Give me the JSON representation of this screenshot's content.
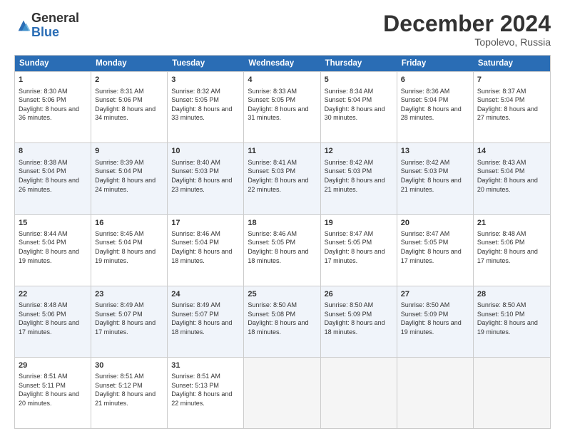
{
  "logo": {
    "general": "General",
    "blue": "Blue"
  },
  "title": "December 2024",
  "location": "Topolevo, Russia",
  "days": [
    "Sunday",
    "Monday",
    "Tuesday",
    "Wednesday",
    "Thursday",
    "Friday",
    "Saturday"
  ],
  "weeks": [
    [
      {
        "day": "1",
        "sunrise": "8:30 AM",
        "sunset": "5:06 PM",
        "daylight": "8 hours and 36 minutes."
      },
      {
        "day": "2",
        "sunrise": "8:31 AM",
        "sunset": "5:06 PM",
        "daylight": "8 hours and 34 minutes."
      },
      {
        "day": "3",
        "sunrise": "8:32 AM",
        "sunset": "5:05 PM",
        "daylight": "8 hours and 33 minutes."
      },
      {
        "day": "4",
        "sunrise": "8:33 AM",
        "sunset": "5:05 PM",
        "daylight": "8 hours and 31 minutes."
      },
      {
        "day": "5",
        "sunrise": "8:34 AM",
        "sunset": "5:04 PM",
        "daylight": "8 hours and 30 minutes."
      },
      {
        "day": "6",
        "sunrise": "8:36 AM",
        "sunset": "5:04 PM",
        "daylight": "8 hours and 28 minutes."
      },
      {
        "day": "7",
        "sunrise": "8:37 AM",
        "sunset": "5:04 PM",
        "daylight": "8 hours and 27 minutes."
      }
    ],
    [
      {
        "day": "8",
        "sunrise": "8:38 AM",
        "sunset": "5:04 PM",
        "daylight": "8 hours and 26 minutes."
      },
      {
        "day": "9",
        "sunrise": "8:39 AM",
        "sunset": "5:04 PM",
        "daylight": "8 hours and 24 minutes."
      },
      {
        "day": "10",
        "sunrise": "8:40 AM",
        "sunset": "5:03 PM",
        "daylight": "8 hours and 23 minutes."
      },
      {
        "day": "11",
        "sunrise": "8:41 AM",
        "sunset": "5:03 PM",
        "daylight": "8 hours and 22 minutes."
      },
      {
        "day": "12",
        "sunrise": "8:42 AM",
        "sunset": "5:03 PM",
        "daylight": "8 hours and 21 minutes."
      },
      {
        "day": "13",
        "sunrise": "8:42 AM",
        "sunset": "5:03 PM",
        "daylight": "8 hours and 21 minutes."
      },
      {
        "day": "14",
        "sunrise": "8:43 AM",
        "sunset": "5:04 PM",
        "daylight": "8 hours and 20 minutes."
      }
    ],
    [
      {
        "day": "15",
        "sunrise": "8:44 AM",
        "sunset": "5:04 PM",
        "daylight": "8 hours and 19 minutes."
      },
      {
        "day": "16",
        "sunrise": "8:45 AM",
        "sunset": "5:04 PM",
        "daylight": "8 hours and 19 minutes."
      },
      {
        "day": "17",
        "sunrise": "8:46 AM",
        "sunset": "5:04 PM",
        "daylight": "8 hours and 18 minutes."
      },
      {
        "day": "18",
        "sunrise": "8:46 AM",
        "sunset": "5:05 PM",
        "daylight": "8 hours and 18 minutes."
      },
      {
        "day": "19",
        "sunrise": "8:47 AM",
        "sunset": "5:05 PM",
        "daylight": "8 hours and 17 minutes."
      },
      {
        "day": "20",
        "sunrise": "8:47 AM",
        "sunset": "5:05 PM",
        "daylight": "8 hours and 17 minutes."
      },
      {
        "day": "21",
        "sunrise": "8:48 AM",
        "sunset": "5:06 PM",
        "daylight": "8 hours and 17 minutes."
      }
    ],
    [
      {
        "day": "22",
        "sunrise": "8:48 AM",
        "sunset": "5:06 PM",
        "daylight": "8 hours and 17 minutes."
      },
      {
        "day": "23",
        "sunrise": "8:49 AM",
        "sunset": "5:07 PM",
        "daylight": "8 hours and 17 minutes."
      },
      {
        "day": "24",
        "sunrise": "8:49 AM",
        "sunset": "5:07 PM",
        "daylight": "8 hours and 18 minutes."
      },
      {
        "day": "25",
        "sunrise": "8:50 AM",
        "sunset": "5:08 PM",
        "daylight": "8 hours and 18 minutes."
      },
      {
        "day": "26",
        "sunrise": "8:50 AM",
        "sunset": "5:09 PM",
        "daylight": "8 hours and 18 minutes."
      },
      {
        "day": "27",
        "sunrise": "8:50 AM",
        "sunset": "5:09 PM",
        "daylight": "8 hours and 19 minutes."
      },
      {
        "day": "28",
        "sunrise": "8:50 AM",
        "sunset": "5:10 PM",
        "daylight": "8 hours and 19 minutes."
      }
    ],
    [
      {
        "day": "29",
        "sunrise": "8:51 AM",
        "sunset": "5:11 PM",
        "daylight": "8 hours and 20 minutes."
      },
      {
        "day": "30",
        "sunrise": "8:51 AM",
        "sunset": "5:12 PM",
        "daylight": "8 hours and 21 minutes."
      },
      {
        "day": "31",
        "sunrise": "8:51 AM",
        "sunset": "5:13 PM",
        "daylight": "8 hours and 22 minutes."
      },
      null,
      null,
      null,
      null
    ]
  ]
}
